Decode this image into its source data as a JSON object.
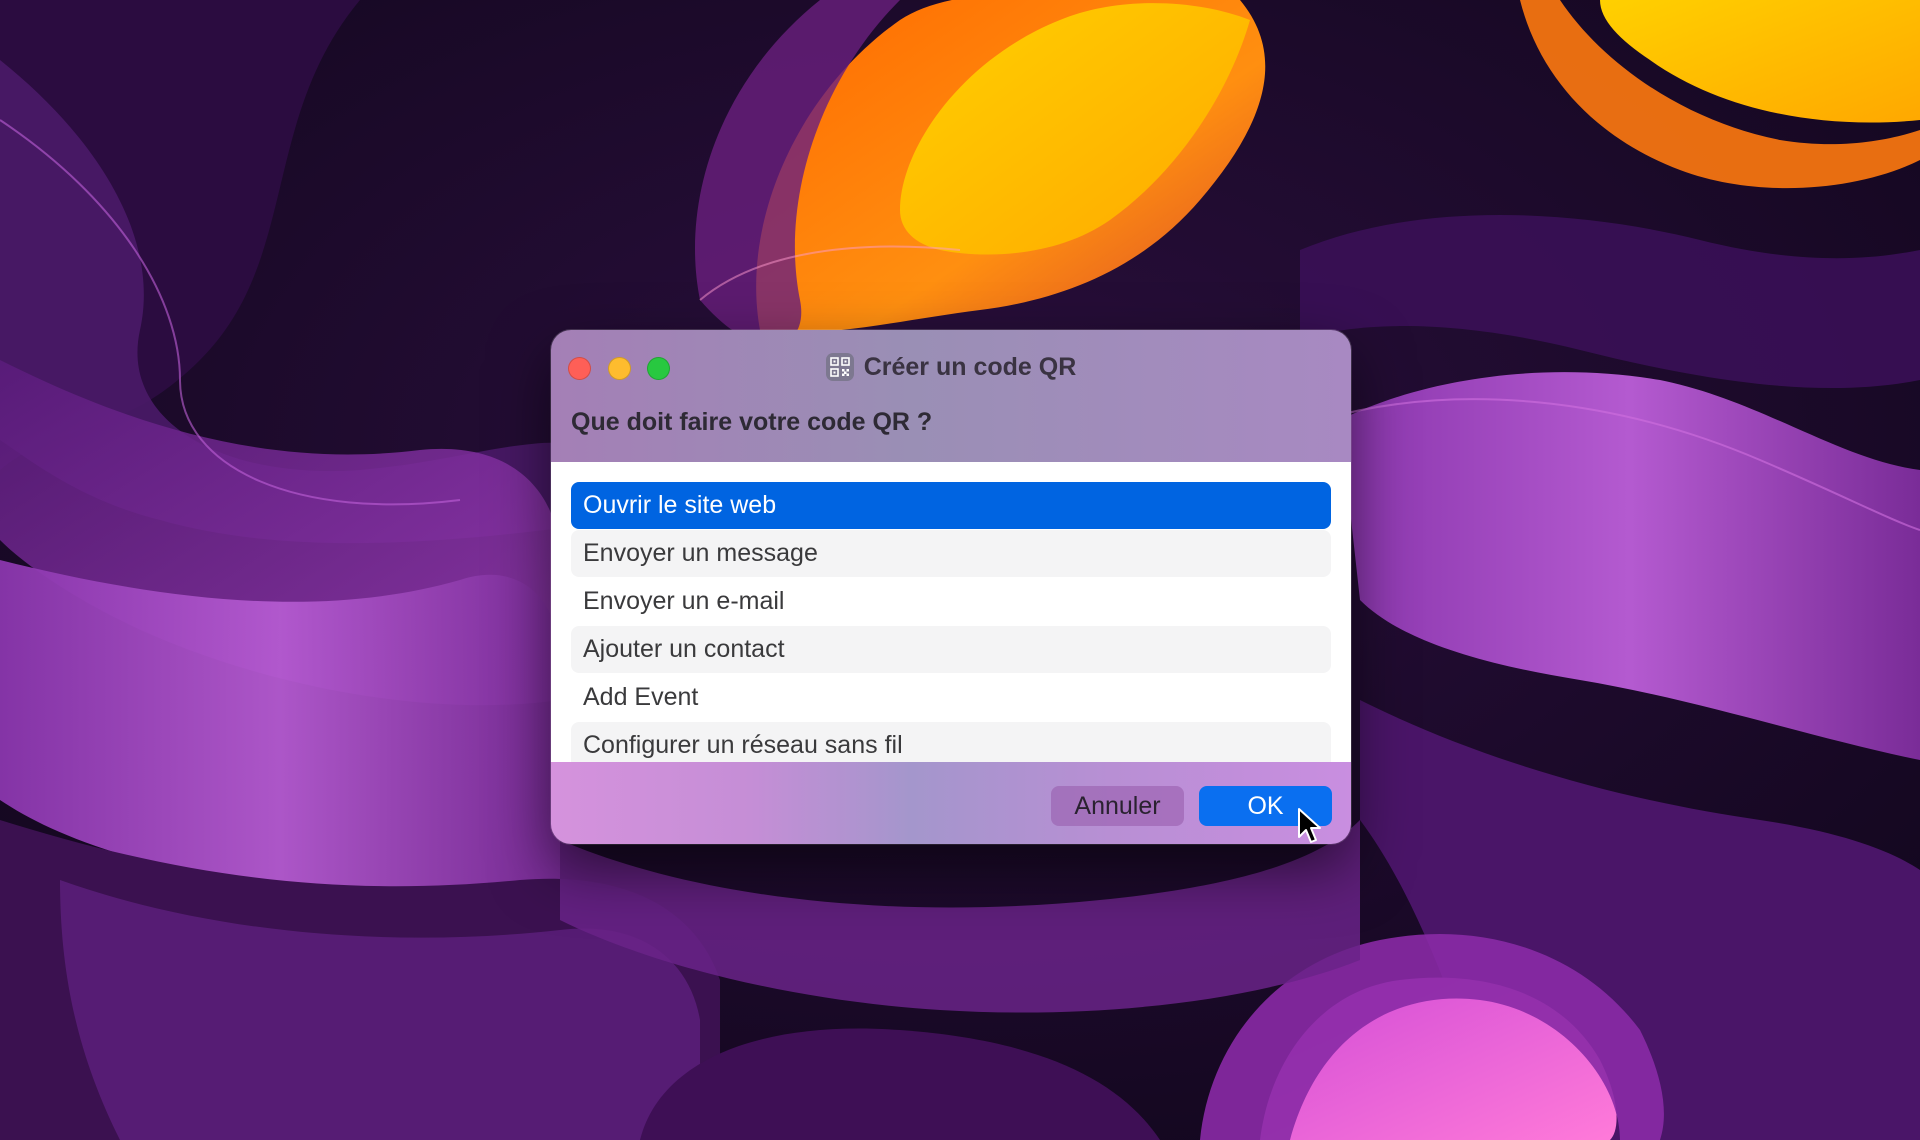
{
  "window": {
    "title": "Créer un code QR",
    "app_icon": "qr-code-icon",
    "prompt": "Que doit faire votre code QR ?"
  },
  "traffic_lights": {
    "close_color": "#fe5f57",
    "minimize_color": "#febc2e",
    "zoom_color": "#28c840"
  },
  "options": [
    {
      "label": "Ouvrir le site web",
      "selected": true
    },
    {
      "label": "Envoyer un message",
      "selected": false
    },
    {
      "label": "Envoyer un e-mail",
      "selected": false
    },
    {
      "label": "Ajouter un contact",
      "selected": false
    },
    {
      "label": "Add Event",
      "selected": false
    },
    {
      "label": "Configurer un réseau sans fil",
      "selected": false
    }
  ],
  "buttons": {
    "cancel_label": "Annuler",
    "ok_label": "OK"
  },
  "colors": {
    "selection": "#0064e1",
    "ok_button": "#0a6ff0"
  }
}
